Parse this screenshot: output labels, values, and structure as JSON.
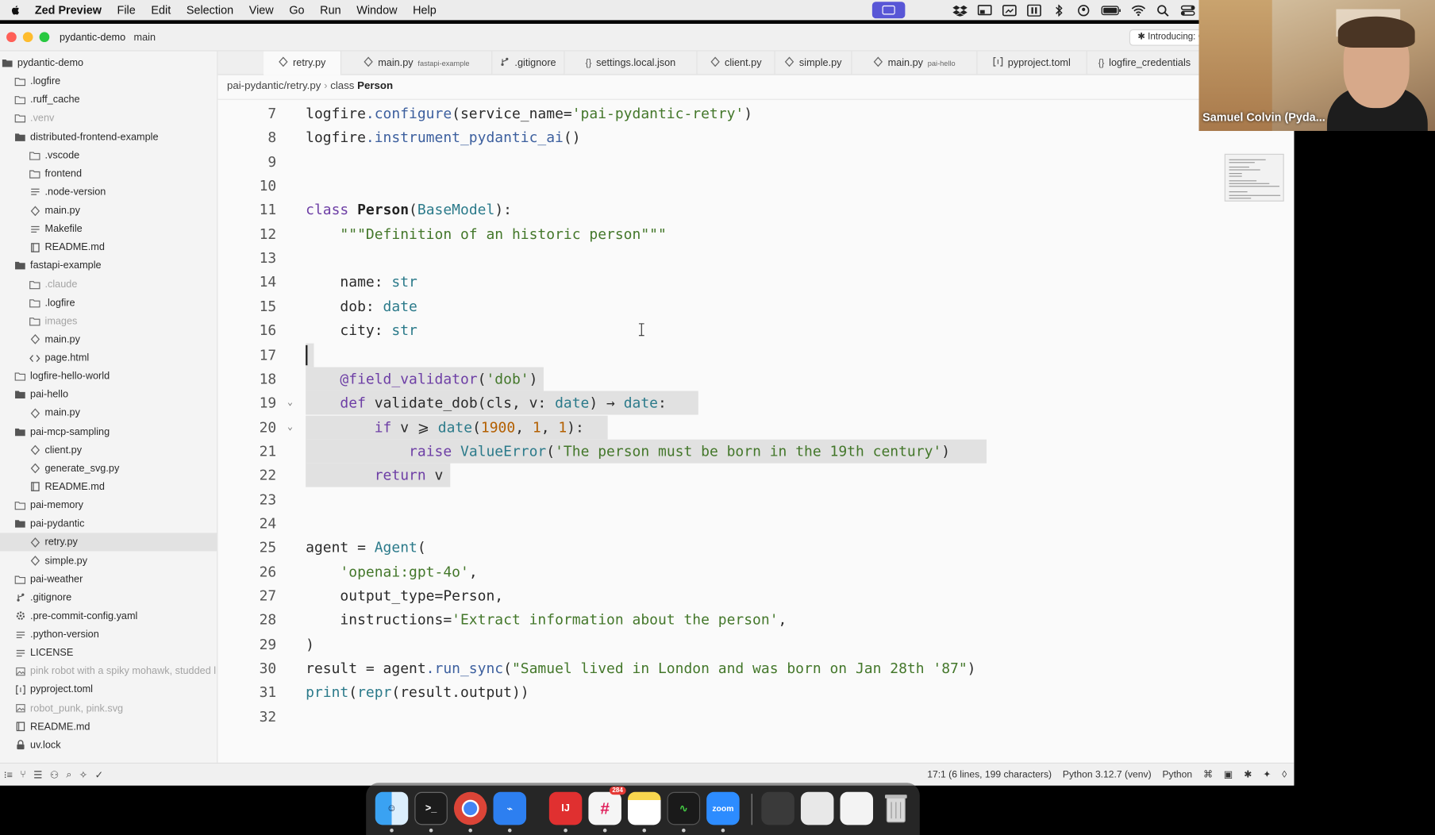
{
  "menubar": {
    "app": "Zed Preview",
    "items": [
      "File",
      "Edit",
      "Selection",
      "View",
      "Go",
      "Run",
      "Window",
      "Help"
    ]
  },
  "titlebar": {
    "project": "pydantic-demo",
    "branch": "main",
    "notice": "Introducing: C"
  },
  "sidebar": {
    "items": [
      {
        "label": "pydantic-demo",
        "icon": "folder-open-icon",
        "level": 0
      },
      {
        "label": ".logfire",
        "icon": "folder-icon",
        "level": 1
      },
      {
        "label": ".ruff_cache",
        "icon": "folder-icon",
        "level": 1
      },
      {
        "label": ".venv",
        "icon": "folder-icon",
        "level": 1,
        "dim": true
      },
      {
        "label": "distributed-frontend-example",
        "icon": "folder-open-icon",
        "level": 1
      },
      {
        "label": ".vscode",
        "icon": "folder-icon",
        "level": 2
      },
      {
        "label": "frontend",
        "icon": "folder-icon",
        "level": 2
      },
      {
        "label": ".node-version",
        "icon": "file-lines-icon",
        "level": 2
      },
      {
        "label": "main.py",
        "icon": "python-file-icon",
        "level": 2
      },
      {
        "label": "Makefile",
        "icon": "file-lines-icon",
        "level": 2
      },
      {
        "label": "README.md",
        "icon": "book-icon",
        "level": 2
      },
      {
        "label": "fastapi-example",
        "icon": "folder-open-icon",
        "level": 1
      },
      {
        "label": ".claude",
        "icon": "folder-icon",
        "level": 2,
        "dim": true
      },
      {
        "label": ".logfire",
        "icon": "folder-icon",
        "level": 2
      },
      {
        "label": "images",
        "icon": "folder-icon",
        "level": 2,
        "dim": true
      },
      {
        "label": "main.py",
        "icon": "python-file-icon",
        "level": 2
      },
      {
        "label": "page.html",
        "icon": "code-file-icon",
        "level": 2
      },
      {
        "label": "logfire-hello-world",
        "icon": "folder-icon",
        "level": 1
      },
      {
        "label": "pai-hello",
        "icon": "folder-open-icon",
        "level": 1
      },
      {
        "label": "main.py",
        "icon": "python-file-icon",
        "level": 2
      },
      {
        "label": "pai-mcp-sampling",
        "icon": "folder-open-icon",
        "level": 1
      },
      {
        "label": "client.py",
        "icon": "python-file-icon",
        "level": 2
      },
      {
        "label": "generate_svg.py",
        "icon": "python-file-icon",
        "level": 2
      },
      {
        "label": "README.md",
        "icon": "book-icon",
        "level": 2
      },
      {
        "label": "pai-memory",
        "icon": "folder-icon",
        "level": 1
      },
      {
        "label": "pai-pydantic",
        "icon": "folder-open-icon",
        "level": 1
      },
      {
        "label": "retry.py",
        "icon": "python-file-icon",
        "level": 2,
        "selected": true
      },
      {
        "label": "simple.py",
        "icon": "python-file-icon",
        "level": 2
      },
      {
        "label": "pai-weather",
        "icon": "folder-icon",
        "level": 1
      },
      {
        "label": ".gitignore",
        "icon": "git-icon",
        "level": 1
      },
      {
        "label": ".pre-commit-config.yaml",
        "icon": "gear-icon",
        "level": 1
      },
      {
        "label": ".python-version",
        "icon": "file-lines-icon",
        "level": 1
      },
      {
        "label": "LICENSE",
        "icon": "file-lines-icon",
        "level": 1
      },
      {
        "label": "pink robot with a spiky mohawk, studded l",
        "icon": "image-icon",
        "level": 1,
        "dim": true
      },
      {
        "label": "pyproject.toml",
        "icon": "toml-icon",
        "level": 1
      },
      {
        "label": "robot_punk, pink.svg",
        "icon": "image-icon",
        "level": 1,
        "dim": true
      },
      {
        "label": "README.md",
        "icon": "book-icon",
        "level": 1
      },
      {
        "label": "uv.lock",
        "icon": "lock-icon",
        "level": 1
      }
    ]
  },
  "tabs": [
    {
      "label": "retry.py",
      "sub": "",
      "icon": "python-file-icon",
      "active": true
    },
    {
      "label": "main.py",
      "sub": "fastapi-example",
      "icon": "python-file-icon"
    },
    {
      "label": ".gitignore",
      "sub": "",
      "icon": "git-icon"
    },
    {
      "label": "settings.local.json",
      "sub": "",
      "icon": "braces-icon"
    },
    {
      "label": "client.py",
      "sub": "",
      "icon": "python-file-icon"
    },
    {
      "label": "simple.py",
      "sub": "",
      "icon": "python-file-icon"
    },
    {
      "label": "main.py",
      "sub": "pai-hello",
      "icon": "python-file-icon"
    },
    {
      "label": "pyproject.toml",
      "sub": "",
      "icon": "toml-icon"
    },
    {
      "label": "logfire_credentials",
      "sub": "",
      "icon": "braces-icon"
    }
  ],
  "breadcrumb": {
    "path": "pai-pydantic/retry.py",
    "sep": "›",
    "kind": "class",
    "symbol": "Person"
  },
  "code": {
    "lines": [
      {
        "n": "7",
        "t": "logfire.configure(service_name='pai-pydantic-retry')"
      },
      {
        "n": "8",
        "t": "logfire.instrument_pydantic_ai()"
      },
      {
        "n": "9",
        "t": ""
      },
      {
        "n": "10",
        "t": ""
      },
      {
        "n": "11",
        "t": "class Person(BaseModel):"
      },
      {
        "n": "12",
        "t": "    \"\"\"Definition of an historic person\"\"\""
      },
      {
        "n": "13",
        "t": ""
      },
      {
        "n": "14",
        "t": "    name: str"
      },
      {
        "n": "15",
        "t": "    dob: date"
      },
      {
        "n": "16",
        "t": "    city: str"
      },
      {
        "n": "17",
        "t": ""
      },
      {
        "n": "18",
        "t": "    @field_validator('dob')"
      },
      {
        "n": "19",
        "t": "    def validate_dob(cls, v: date) → date:"
      },
      {
        "n": "20",
        "t": "        if v ⩾ date(1900, 1, 1):"
      },
      {
        "n": "21",
        "t": "            raise ValueError('The person must be born in the 19th century')"
      },
      {
        "n": "22",
        "t": "        return v"
      },
      {
        "n": "23",
        "t": ""
      },
      {
        "n": "24",
        "t": ""
      },
      {
        "n": "25",
        "t": "agent = Agent("
      },
      {
        "n": "26",
        "t": "    'openai:gpt-4o',"
      },
      {
        "n": "27",
        "t": "    output_type=Person,"
      },
      {
        "n": "28",
        "t": "    instructions='Extract information about the person',"
      },
      {
        "n": "29",
        "t": ")"
      },
      {
        "n": "30",
        "t": "result = agent.run_sync(\"Samuel lived in London and was born on Jan 28th '87\")"
      },
      {
        "n": "31",
        "t": "print(repr(result.output))"
      },
      {
        "n": "32",
        "t": ""
      }
    ]
  },
  "statusbar": {
    "position": "17:1 (6 lines, 199 characters)",
    "python_env": "Python 3.12.7 (venv)",
    "language": "Python"
  },
  "dock": {
    "apps": [
      "finder",
      "terminal",
      "chrome",
      "xcode",
      "intellij",
      "slack",
      "notes",
      "activity-monitor",
      "zoom",
      "finder-window",
      "preview-window",
      "chrome-window",
      "trash"
    ],
    "slack_badge": "284",
    "zoom_label": "zoom"
  },
  "webcam": {
    "name": "Samuel Colvin (Pyda..."
  },
  "colors": {
    "selection": "#e1e1e1",
    "keyword": "#6d3ea5",
    "string": "#43772a",
    "number": "#b35f00"
  }
}
